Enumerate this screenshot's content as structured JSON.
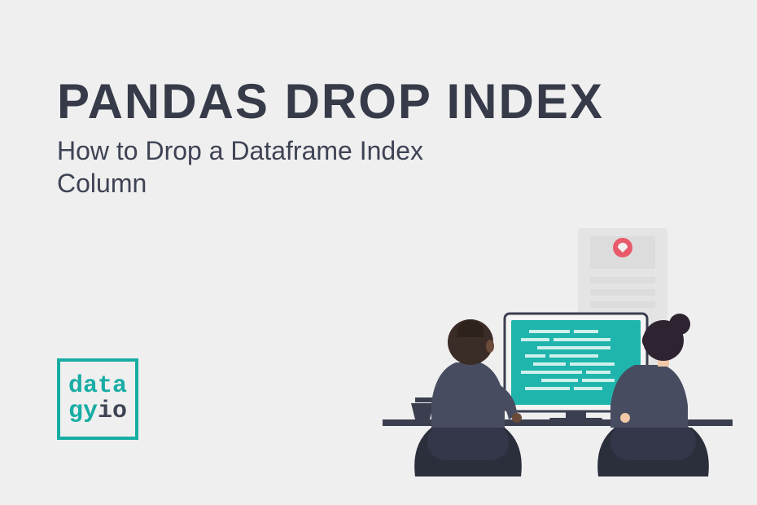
{
  "title": "PANDAS DROP INDEX",
  "subtitle": "How to Drop a Dataframe Index Column",
  "logo": {
    "line1": "data",
    "line2_a": "gy",
    "line2_b": "io"
  },
  "illustration": {
    "semantic": "two-people-coding-at-computer"
  }
}
